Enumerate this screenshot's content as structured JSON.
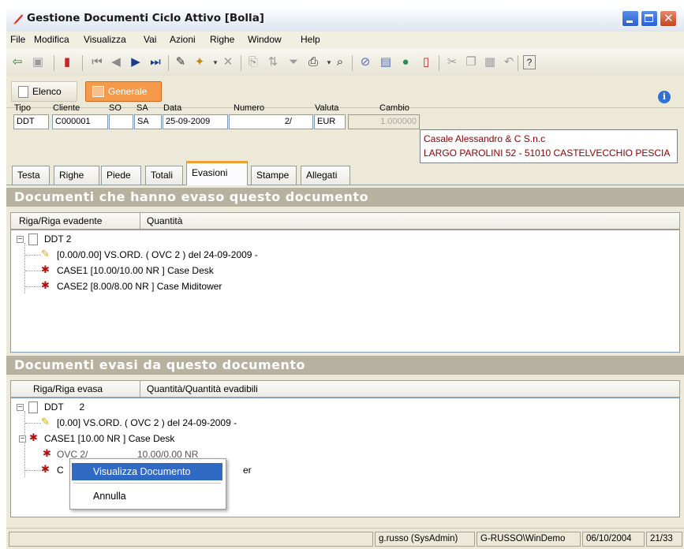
{
  "window": {
    "title": "Gestione Documenti Ciclo Attivo [Bolla]"
  },
  "menu": [
    "File",
    "Modifica",
    "Visualizza",
    "Vai",
    "Azioni",
    "Righe",
    "Window",
    "Help"
  ],
  "views": {
    "elenco": "Elenco",
    "generale": "Generale"
  },
  "header": {
    "labels": {
      "tipo": "Tipo",
      "cliente": "Cliente",
      "so": "SO",
      "sa": "SA",
      "data": "Data",
      "numero": "Numero",
      "valuta": "Valuta",
      "cambio": "Cambio"
    },
    "values": {
      "tipo": "DDT",
      "cliente": "C000001",
      "so": "",
      "sa": "SA",
      "data": "25-09-2009",
      "numero": "2/",
      "valuta": "EUR",
      "cambio": "1.000000"
    },
    "address": {
      "line1": "Casale Alessandro & C S.n.c",
      "line2": "LARGO PAROLINI 52 - 51010 CASTELVECCHIO PESCIA"
    }
  },
  "tabs": [
    "Testa",
    "Righe",
    "Piede",
    "Totali",
    "Evasioni",
    "Stampe",
    "Allegati"
  ],
  "active_tab": "Evasioni",
  "section1": {
    "title": "Documenti che hanno evaso questo documento",
    "columns": [
      "Riga/Riga evadente",
      "Quantità"
    ],
    "root": "DDT 2",
    "rows": [
      "[0.00/0.00] VS.ORD.  ( OVC    2    ) del 24-09-2009 -",
      "CASE1 [10.00/10.00 NR ] Case Desk",
      "CASE2 [8.00/8.00 NR ] Case Miditower"
    ]
  },
  "section2": {
    "title": "Documenti evasi da questo documento",
    "columns": [
      "Riga/Riga evasa",
      "Quantità/Quantità evadibili"
    ],
    "root": "DDT      2",
    "rows": [
      "[0.00] VS.ORD.  ( OVC    2    ) del 24-09-2009 -",
      "CASE1 [10.00 NR ] Case Desk",
      "OVC 2/",
      "10.00/0.00 NR",
      "C",
      "er"
    ]
  },
  "context_menu": [
    "Visualizza Documento",
    "Annulla"
  ],
  "status": {
    "user": "g.russo (SysAdmin)",
    "workstation": "G-RUSSO\\WinDemo",
    "date": "06/10/2004",
    "pages": "21/33"
  },
  "colors": {
    "accent": "#f59a4a",
    "selection": "#316ac5",
    "section_band": "#b7b2a0",
    "address_text": "#8b0000"
  }
}
